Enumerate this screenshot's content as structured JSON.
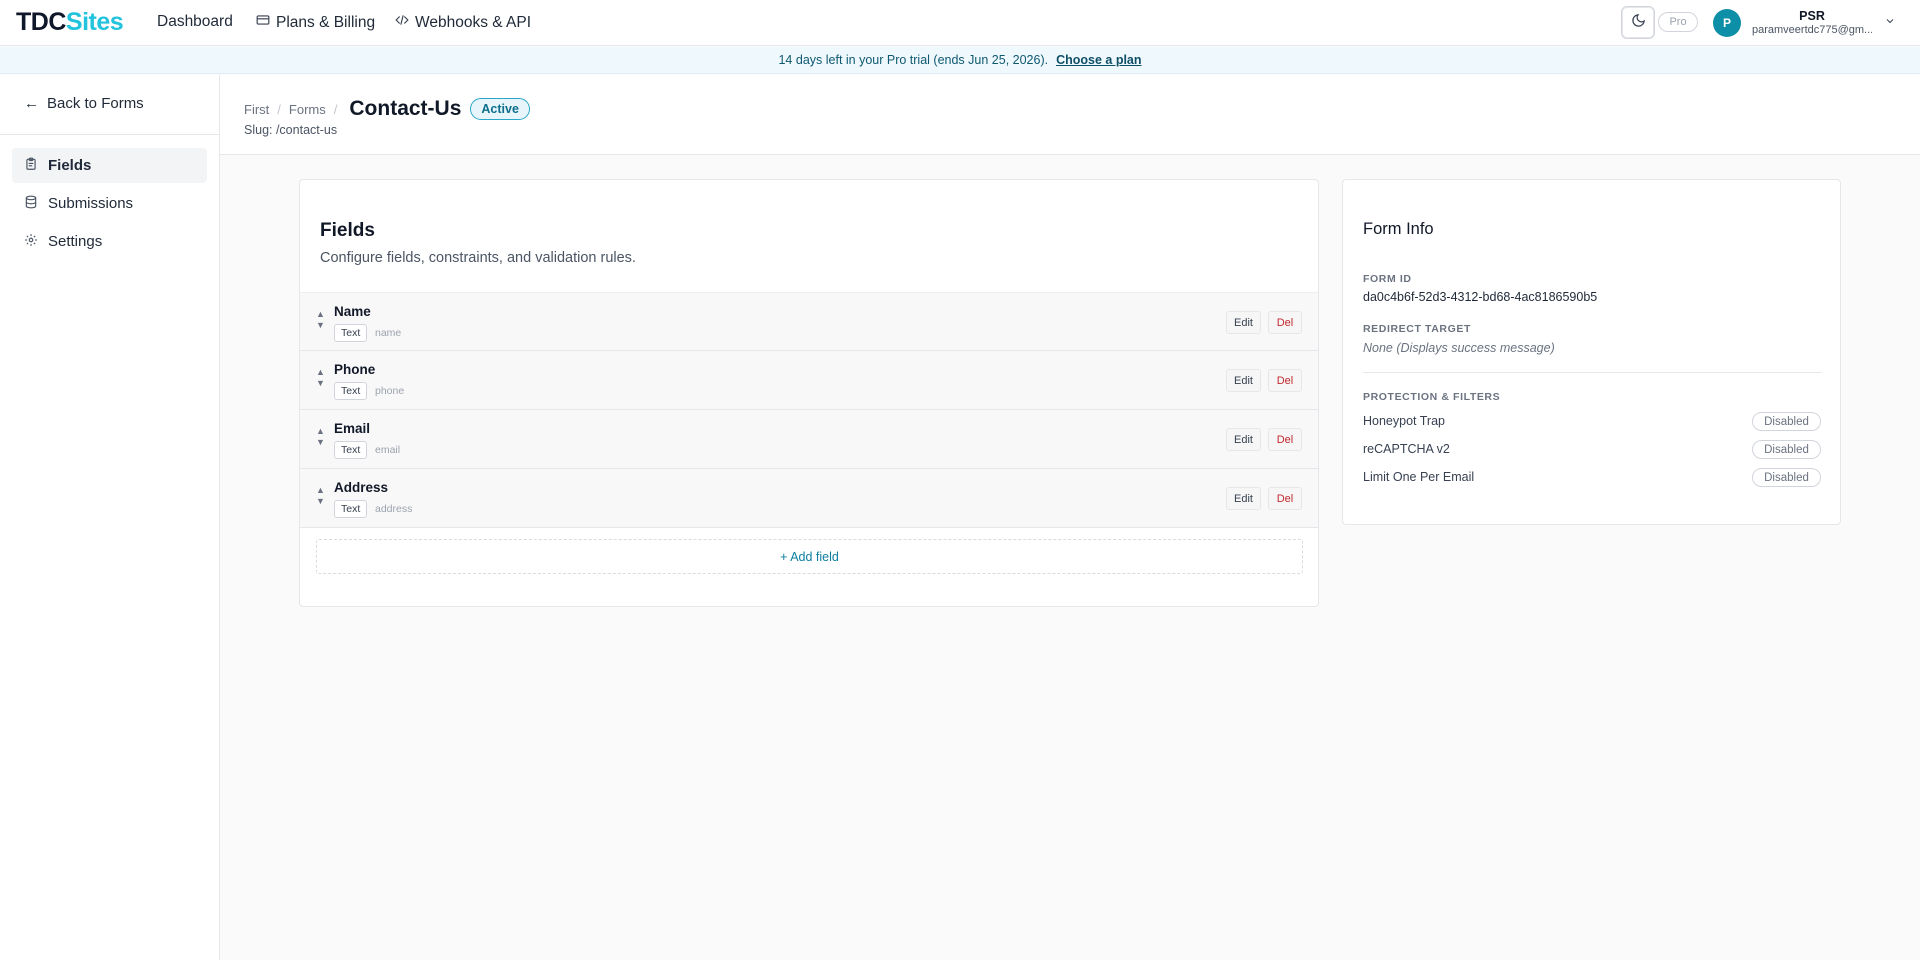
{
  "brand": {
    "part1": "TDC",
    "part2": "Sites"
  },
  "nav": {
    "dashboard": "Dashboard",
    "billing": "Plans & Billing",
    "webhooks": "Webhooks & API"
  },
  "header_right": {
    "plan_badge": "Pro",
    "account": {
      "initial": "P",
      "name": "PSR",
      "email": "paramveertdc775@gm..."
    }
  },
  "banner": {
    "text": "14 days left in your Pro trial (ends Jun 25, 2026).",
    "cta": "Choose a plan"
  },
  "sidebar": {
    "back": "Back to Forms",
    "items": [
      {
        "label": "Fields"
      },
      {
        "label": "Submissions"
      },
      {
        "label": "Settings"
      }
    ]
  },
  "page": {
    "breadcrumb": [
      "First",
      "Forms"
    ],
    "title": "Contact-Us",
    "status": "Active",
    "slug": "Slug: /contact-us"
  },
  "fields_card": {
    "title": "Fields",
    "subtitle": "Configure fields, constraints, and validation rules.",
    "edit_label": "Edit",
    "del_label": "Del",
    "add_label": "+ Add field",
    "rows": [
      {
        "label": "Name",
        "type": "Text",
        "key": "name"
      },
      {
        "label": "Phone",
        "type": "Text",
        "key": "phone"
      },
      {
        "label": "Email",
        "type": "Text",
        "key": "email"
      },
      {
        "label": "Address",
        "type": "Text",
        "key": "address"
      }
    ]
  },
  "info_card": {
    "title": "Form Info",
    "form_id_label": "FORM ID",
    "form_id": "da0c4b6f-52d3-4312-bd68-4ac8186590b5",
    "redirect_label": "REDIRECT TARGET",
    "redirect_value": "None (Displays success message)",
    "protection_label": "PROTECTION & FILTERS",
    "protections": [
      {
        "label": "Honeypot Trap",
        "status": "Disabled"
      },
      {
        "label": "reCAPTCHA v2",
        "status": "Disabled"
      },
      {
        "label": "Limit One Per Email",
        "status": "Disabled"
      }
    ]
  },
  "colors": {
    "brand_accent": "#22c3dd",
    "avatar": "#0e8fa8",
    "delete": "#c2272d",
    "banner_bg": "#eef8fd"
  }
}
